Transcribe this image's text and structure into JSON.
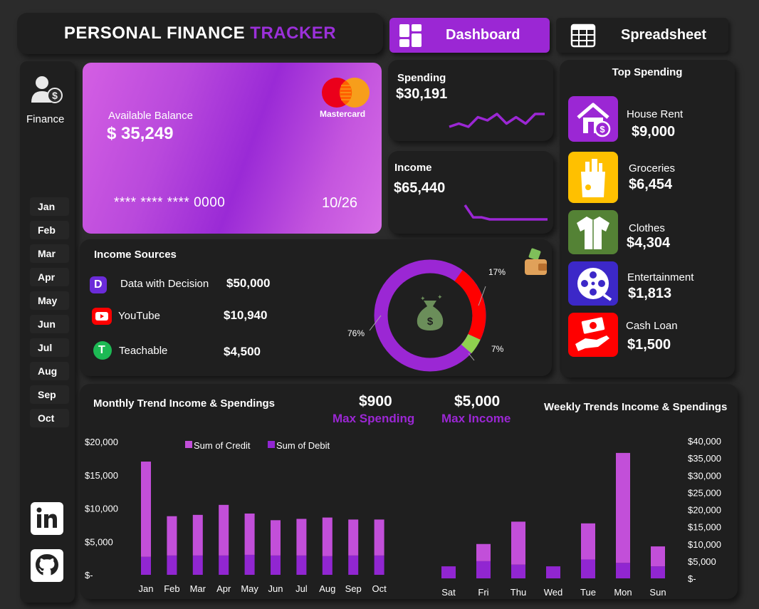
{
  "header": {
    "title_main": "PERSONAL FINANCE",
    "title_accent": "TRACKER",
    "tab_dashboard": "Dashboard",
    "tab_spreadsheet": "Spreadsheet"
  },
  "sidebar": {
    "finance_label": "Finance",
    "months": [
      "Jan",
      "Feb",
      "Mar",
      "Apr",
      "May",
      "Jun",
      "Jul",
      "Aug",
      "Sep",
      "Oct"
    ]
  },
  "card": {
    "balance_label": "Available Balance",
    "balance_value": "$ 35,249",
    "brand": "Mastercard",
    "number": "**** **** **** 0000",
    "expiry": "10/26"
  },
  "spending": {
    "label": "Spending",
    "value": "$30,191",
    "trend": [
      3,
      4,
      3,
      6,
      5,
      7,
      4,
      6,
      4,
      7,
      7
    ]
  },
  "income": {
    "label": "Income",
    "value": "$65,440",
    "trend": [
      9,
      3,
      3,
      2,
      2,
      2,
      2,
      2,
      2,
      2,
      2
    ]
  },
  "top_spending": {
    "title": "Top Spending",
    "items": [
      {
        "name": "House Rent",
        "value": "$9,000",
        "color": "#9b27d4",
        "icon": "house-icon"
      },
      {
        "name": "Groceries",
        "value": "$6,454",
        "color": "#ffc000",
        "icon": "grocery-bag-icon"
      },
      {
        "name": "Clothes",
        "value": "$4,304",
        "color": "#548235",
        "icon": "shirt-icon"
      },
      {
        "name": "Entertainment",
        "value": "$1,813",
        "color": "#3c28c8",
        "icon": "film-reel-icon"
      },
      {
        "name": "Cash Loan",
        "value": "$1,500",
        "color": "#ff0000",
        "icon": "cash-hand-icon"
      }
    ]
  },
  "income_sources": {
    "title": "Income Sources",
    "items": [
      {
        "name": "Data with Decision",
        "value": "$50,000",
        "icon": "data-with-decision-icon",
        "color": "#6b2bd9"
      },
      {
        "name": "YouTube",
        "value": "$10,940",
        "icon": "youtube-icon",
        "color": "#ff0000"
      },
      {
        "name": "Teachable",
        "value": "$4,500",
        "icon": "teachable-icon",
        "color": "#1db954"
      }
    ],
    "donut_labels": [
      "76%",
      "17%",
      "7%"
    ]
  },
  "stats": {
    "max_spending_value": "$900",
    "max_spending_label": "Max Spending",
    "max_income_value": "$5,000",
    "max_income_label": "Max Income"
  },
  "chart_data": [
    {
      "type": "bar",
      "title": "Monthly Trend Income & Spendings",
      "categories": [
        "Jan",
        "Feb",
        "Mar",
        "Apr",
        "May",
        "Jun",
        "Jul",
        "Aug",
        "Sep",
        "Oct"
      ],
      "series": [
        {
          "name": "Sum of Credit",
          "values": [
            14300,
            5900,
            6100,
            7600,
            6200,
            5300,
            5500,
            5800,
            5400,
            5400
          ]
        },
        {
          "name": "Sum of Debit",
          "values": [
            2700,
            2900,
            2900,
            2900,
            3000,
            2900,
            2900,
            2800,
            2900,
            2900
          ]
        }
      ],
      "stacked": true,
      "yticks": [
        "$20,000",
        "$15,000",
        "$10,000",
        "$5,000",
        "$-"
      ],
      "ylim": [
        0,
        20000
      ],
      "colors": [
        "#c24fd9",
        "#9126d1"
      ]
    },
    {
      "type": "bar",
      "title": "Weekly Trends Income & Spendings",
      "categories": [
        "Sat",
        "Fri",
        "Thu",
        "Wed",
        "Tue",
        "Mon",
        "Sun"
      ],
      "series": [
        {
          "name": "Sum of Credit",
          "values": [
            0,
            5000,
            12500,
            0,
            10500,
            32000,
            5800
          ]
        },
        {
          "name": "Sum of Debit",
          "values": [
            3500,
            5000,
            4000,
            3500,
            5500,
            4500,
            3500
          ]
        }
      ],
      "stacked": true,
      "yticks": [
        "$40,000",
        "$35,000",
        "$30,000",
        "$25,000",
        "$20,000",
        "$15,000",
        "$10,000",
        "$5,000",
        "$-"
      ],
      "ylim": [
        0,
        40000
      ],
      "colors": [
        "#c24fd9",
        "#9126d1"
      ]
    }
  ]
}
